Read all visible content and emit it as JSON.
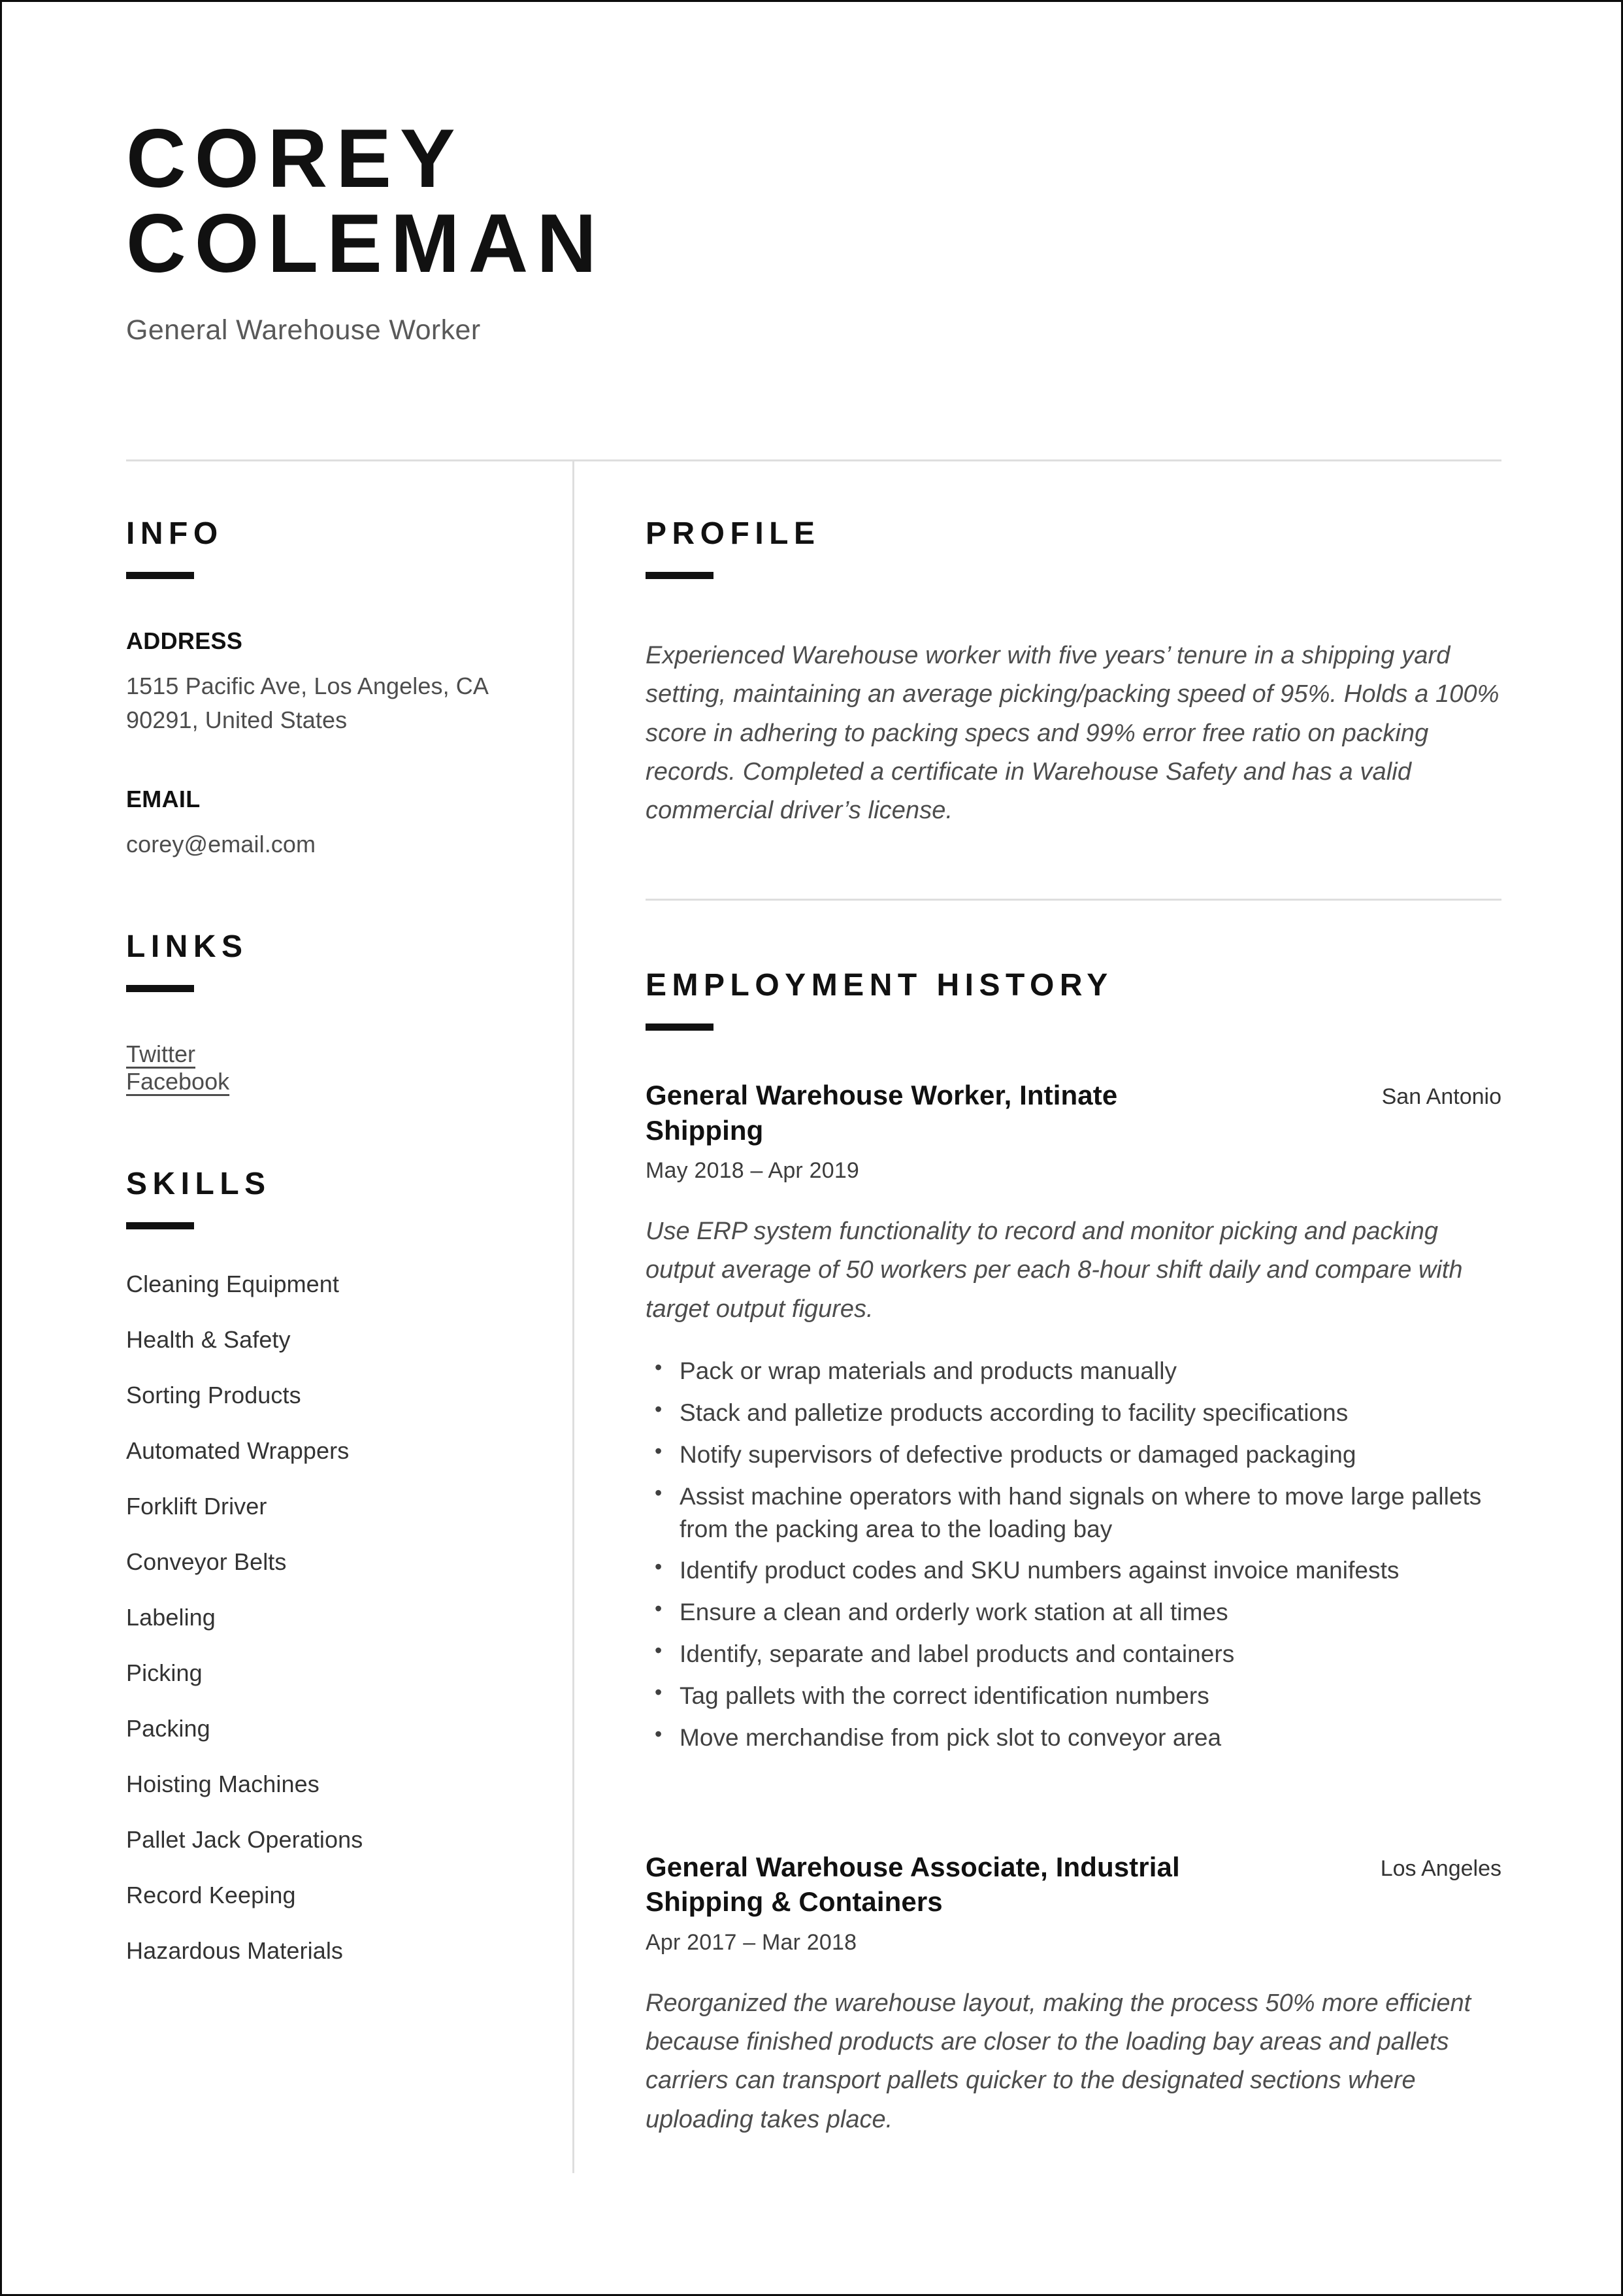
{
  "header": {
    "first_name": "COREY",
    "last_name": "COLEMAN",
    "job_subtitle": "General Warehouse Worker"
  },
  "sidebar": {
    "info": {
      "heading": "INFO",
      "address_label": "ADDRESS",
      "address_value": "1515 Pacific Ave, Los Angeles, CA 90291, United States",
      "email_label": "EMAIL",
      "email_value": "corey@email.com"
    },
    "links": {
      "heading": "LINKS",
      "items": [
        {
          "label": "Twitter"
        },
        {
          "label": "Facebook"
        }
      ]
    },
    "skills": {
      "heading": "SKILLS",
      "items": [
        "Cleaning Equipment",
        "Health & Safety",
        "Sorting Products",
        "Automated Wrappers",
        "Forklift Driver",
        "Conveyor Belts",
        "Labeling",
        "Picking",
        "Packing",
        "Hoisting Machines",
        "Pallet Jack Operations",
        "Record Keeping",
        "Hazardous Materials"
      ]
    }
  },
  "main": {
    "profile": {
      "heading": "PROFILE",
      "text": " Experienced Warehouse worker with five years’ tenure in a shipping yard setting, maintaining an average picking/packing speed of 95%. Holds a 100% score in adhering to packing specs and 99% error free ratio on packing records. Completed a certificate in Warehouse Safety and has a valid commercial driver’s license."
    },
    "employment": {
      "heading": "EMPLOYMENT HISTORY",
      "jobs": [
        {
          "title": "General Warehouse Worker, Intinate Shipping",
          "location": "San Antonio",
          "dates": "May 2018 – Apr 2019",
          "summary": "Use ERP system functionality to record and monitor picking and packing output average of 50 workers per each 8-hour shift daily and compare with target output figures.",
          "bullets": [
            "Pack or wrap materials and products manually",
            "Stack and palletize products according to facility specifications",
            "Notify supervisors of defective products or damaged packaging",
            "Assist machine operators with hand signals on where to move large pallets from the packing area to the loading bay",
            "Identify product codes and SKU numbers against invoice manifests",
            "Ensure a clean and orderly work station at all times",
            "Identify, separate and label products and containers",
            "Tag pallets with the correct identification numbers",
            "Move merchandise from pick slot to conveyor area"
          ]
        },
        {
          "title": "General Warehouse Associate, Industrial Shipping & Containers",
          "location": "Los Angeles",
          "dates": "Apr 2017 – Mar 2018",
          "summary": "Reorganized the warehouse layout, making the process 50% more efficient because finished products are closer to the loading bay areas and pallets carriers can transport pallets quicker to the designated sections where uploading takes place.",
          "bullets": []
        }
      ]
    }
  },
  "colors": {
    "ink": "#111111",
    "body_text": "#4d4d4d",
    "rule": "#dedede",
    "page_border": "#0d0d0d"
  }
}
